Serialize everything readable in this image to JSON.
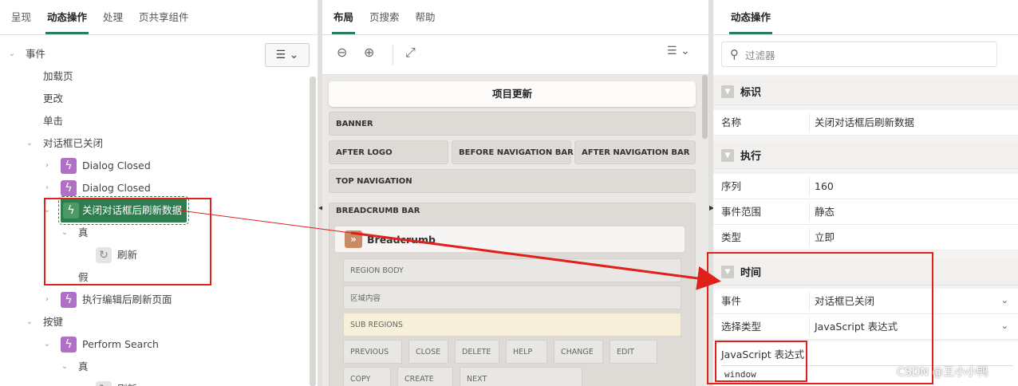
{
  "left": {
    "tabs": [
      "呈现",
      "动态操作",
      "处理",
      "页共享组件"
    ],
    "active_tab": 1,
    "tree": [
      {
        "label": "事件",
        "level": 0,
        "twisty": "v",
        "icon": ""
      },
      {
        "label": "加载页",
        "level": 1,
        "twisty": "",
        "icon": ""
      },
      {
        "label": "更改",
        "level": 1,
        "twisty": "",
        "icon": ""
      },
      {
        "label": "单击",
        "level": 1,
        "twisty": "",
        "icon": ""
      },
      {
        "label": "对话框已关闭",
        "level": 1,
        "twisty": "v",
        "icon": ""
      },
      {
        "label": "Dialog Closed",
        "level": 2,
        "twisty": ">",
        "icon": "da"
      },
      {
        "label": "Dialog Closed",
        "level": 2,
        "twisty": ">",
        "icon": "da"
      },
      {
        "label": "关闭对话框后刷新数据",
        "level": 2,
        "twisty": "v",
        "icon": "da",
        "selected": true
      },
      {
        "label": "真",
        "level": 3,
        "twisty": "v",
        "icon": ""
      },
      {
        "label": "刷新",
        "level": 4,
        "twisty": "",
        "icon": "refresh"
      },
      {
        "label": "假",
        "level": 3,
        "twisty": "",
        "icon": ""
      },
      {
        "label": "执行编辑后刷新页面",
        "level": 2,
        "twisty": ">",
        "icon": "da"
      },
      {
        "label": "按键",
        "level": 1,
        "twisty": "v",
        "icon": ""
      },
      {
        "label": "Perform Search",
        "level": 2,
        "twisty": "v",
        "icon": "da"
      },
      {
        "label": "真",
        "level": 3,
        "twisty": "v",
        "icon": ""
      },
      {
        "label": "刷新",
        "level": 4,
        "twisty": "",
        "icon": "refresh"
      }
    ]
  },
  "mid": {
    "tabs": [
      "布局",
      "页搜索",
      "帮助"
    ],
    "active_tab": 0,
    "page_title": "项目更新",
    "banner": "BANNER",
    "after_logo": "AFTER LOGO",
    "before_nav": "BEFORE NAVIGATION BAR",
    "after_nav": "AFTER NAVIGATION BAR",
    "top_nav": "TOP NAVIGATION",
    "breadcrumb_bar": "BREADCRUMB BAR",
    "breadcrumb_region": "Breadcrumb",
    "region_body": "REGION BODY",
    "region_content": "区域内容",
    "sub_regions": "SUB REGIONS",
    "buttons_row1": [
      "PREVIOUS",
      "CLOSE",
      "DELETE",
      "HELP",
      "CHANGE",
      "EDIT"
    ],
    "buttons_row2": [
      "COPY",
      "CREATE",
      "NEXT"
    ]
  },
  "right": {
    "tab": "动态操作",
    "filter_placeholder": "过滤器",
    "groups": {
      "identification": "标识",
      "execution": "执行",
      "when": "时间"
    },
    "props": {
      "name_label": "名称",
      "name_value": "关闭对话框后刷新数据",
      "sequence_label": "序列",
      "sequence_value": "160",
      "scope_label": "事件范围",
      "scope_value": "静态",
      "type_label": "类型",
      "type_value": "立即",
      "event_label": "事件",
      "event_value": "对话框已关闭",
      "selection_type_label": "选择类型",
      "selection_type_value": "JavaScript 表达式",
      "js_expr_label": "JavaScript 表达式",
      "js_expr_value": "window"
    }
  },
  "watermark": "CSDN @王小小鸭",
  "colors": {
    "accent_green": "#2d7c5c",
    "dynamic_action_purple": "#b070c6",
    "annotation_red": "#e0201b"
  }
}
